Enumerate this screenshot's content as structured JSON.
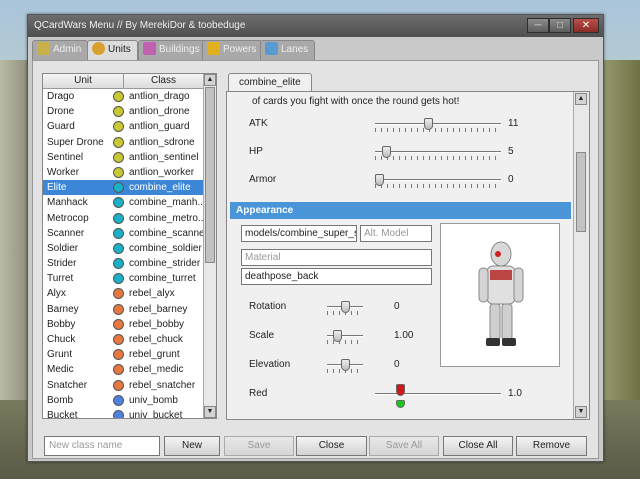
{
  "window": {
    "title": "QCardWars Menu  //  By MerekiDor & toobeduge",
    "controls": {
      "minimize": "─",
      "maximize": "□",
      "close": "✕"
    }
  },
  "tabs": [
    {
      "label": "Admin",
      "icon": "shield-icon",
      "color": "#c9b04a"
    },
    {
      "label": "Units",
      "icon": "smiley-icon",
      "color": "#d9a030"
    },
    {
      "label": "Buildings",
      "icon": "puzzle-icon",
      "color": "#c060b0"
    },
    {
      "label": "Powers",
      "icon": "lightning-icon",
      "color": "#e0b020"
    },
    {
      "label": "Lanes",
      "icon": "picture-icon",
      "color": "#5a9ad0"
    }
  ],
  "list": {
    "headers": {
      "unit": "Unit",
      "class": "Class"
    },
    "rows": [
      {
        "unit": "Drago",
        "class": "antlion_drago",
        "color": "#c8c832"
      },
      {
        "unit": "Drone",
        "class": "antlion_drone",
        "color": "#c8c832"
      },
      {
        "unit": "Guard",
        "class": "antlion_guard",
        "color": "#c8c832"
      },
      {
        "unit": "Super Drone",
        "class": "antlion_sdrone",
        "color": "#c8c832"
      },
      {
        "unit": "Sentinel",
        "class": "antlion_sentinel",
        "color": "#c8c832"
      },
      {
        "unit": "Worker",
        "class": "antlion_worker",
        "color": "#c8c832"
      },
      {
        "unit": "Elite",
        "class": "combine_elite",
        "color": "#1ab0c8",
        "selected": true
      },
      {
        "unit": "Manhack",
        "class": "combine_manh...",
        "color": "#1ab0c8"
      },
      {
        "unit": "Metrocop",
        "class": "combine_metro...",
        "color": "#1ab0c8"
      },
      {
        "unit": "Scanner",
        "class": "combine_scanner",
        "color": "#1ab0c8"
      },
      {
        "unit": "Soldier",
        "class": "combine_soldier",
        "color": "#1ab0c8"
      },
      {
        "unit": "Strider",
        "class": "combine_strider",
        "color": "#1ab0c8"
      },
      {
        "unit": "Turret",
        "class": "combine_turret",
        "color": "#1ab0c8"
      },
      {
        "unit": "Alyx",
        "class": "rebel_alyx",
        "color": "#e87840"
      },
      {
        "unit": "Barney",
        "class": "rebel_barney",
        "color": "#e87840"
      },
      {
        "unit": "Bobby",
        "class": "rebel_bobby",
        "color": "#e87840"
      },
      {
        "unit": "Chuck",
        "class": "rebel_chuck",
        "color": "#e87840"
      },
      {
        "unit": "Grunt",
        "class": "rebel_grunt",
        "color": "#e87840"
      },
      {
        "unit": "Medic",
        "class": "rebel_medic",
        "color": "#e87840"
      },
      {
        "unit": "Snatcher",
        "class": "rebel_snatcher",
        "color": "#e87840"
      },
      {
        "unit": "Bomb",
        "class": "univ_bomb",
        "color": "#5080e0"
      },
      {
        "unit": "Bucket",
        "class": "univ_bucket",
        "color": "#5080e0"
      }
    ]
  },
  "editor": {
    "tab_label": "combine_elite",
    "description_tail": "of cards you fight with once the round gets hot!",
    "stats": [
      {
        "label": "ATK",
        "value": "11",
        "level": 0.42
      },
      {
        "label": "HP",
        "value": "5",
        "level": 0.06
      },
      {
        "label": "Armor",
        "value": "0",
        "level": 0.0
      }
    ],
    "appearance_title": "Appearance",
    "model_value": "models/combine_super_so",
    "alt_model_placeholder": "Alt. Model",
    "material_placeholder": "Material",
    "deathpose_value": "deathpose_back",
    "props": [
      {
        "label": "Rotation",
        "value": "0",
        "level": 0.5
      },
      {
        "label": "Scale",
        "value": "1.00",
        "level": 0.22
      },
      {
        "label": "Elevation",
        "value": "0",
        "level": 0.5
      }
    ],
    "color_label": "Red",
    "color_value": "1.0",
    "color_level": 0.18
  },
  "bottom": {
    "new_class_placeholder": "New class name",
    "new_label": "New",
    "save_label": "Save",
    "close_label": "Close",
    "save_all_label": "Save All",
    "close_all_label": "Close All",
    "remove_label": "Remove"
  }
}
